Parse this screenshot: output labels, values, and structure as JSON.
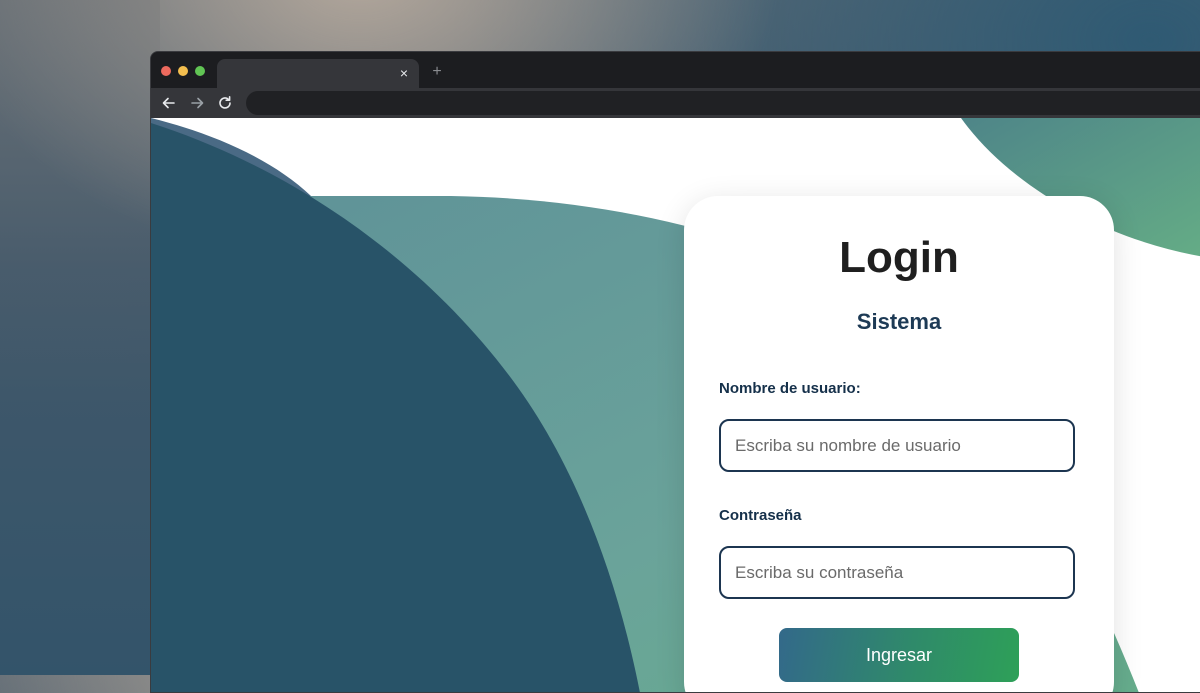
{
  "browser": {
    "tab_close_glyph": "×",
    "new_tab_glyph": "+",
    "icons": [
      "back-arrow-icon",
      "forward-arrow-icon",
      "reload-icon"
    ],
    "address": ""
  },
  "login": {
    "title": "Login",
    "subtitle": "Sistema",
    "username_label": "Nombre de usuario:",
    "username_placeholder": "Escriba su nombre de usuario",
    "username_value": "",
    "password_label": "Contraseña",
    "password_placeholder": "Escriba su contraseña",
    "password_value": "",
    "submit_label": "Ingresar"
  },
  "colors": {
    "dark_teal": "#285368",
    "mid_teal": "#6a9e9e",
    "green_accent": "#5fa986",
    "heading_navy": "#1d3a55"
  }
}
